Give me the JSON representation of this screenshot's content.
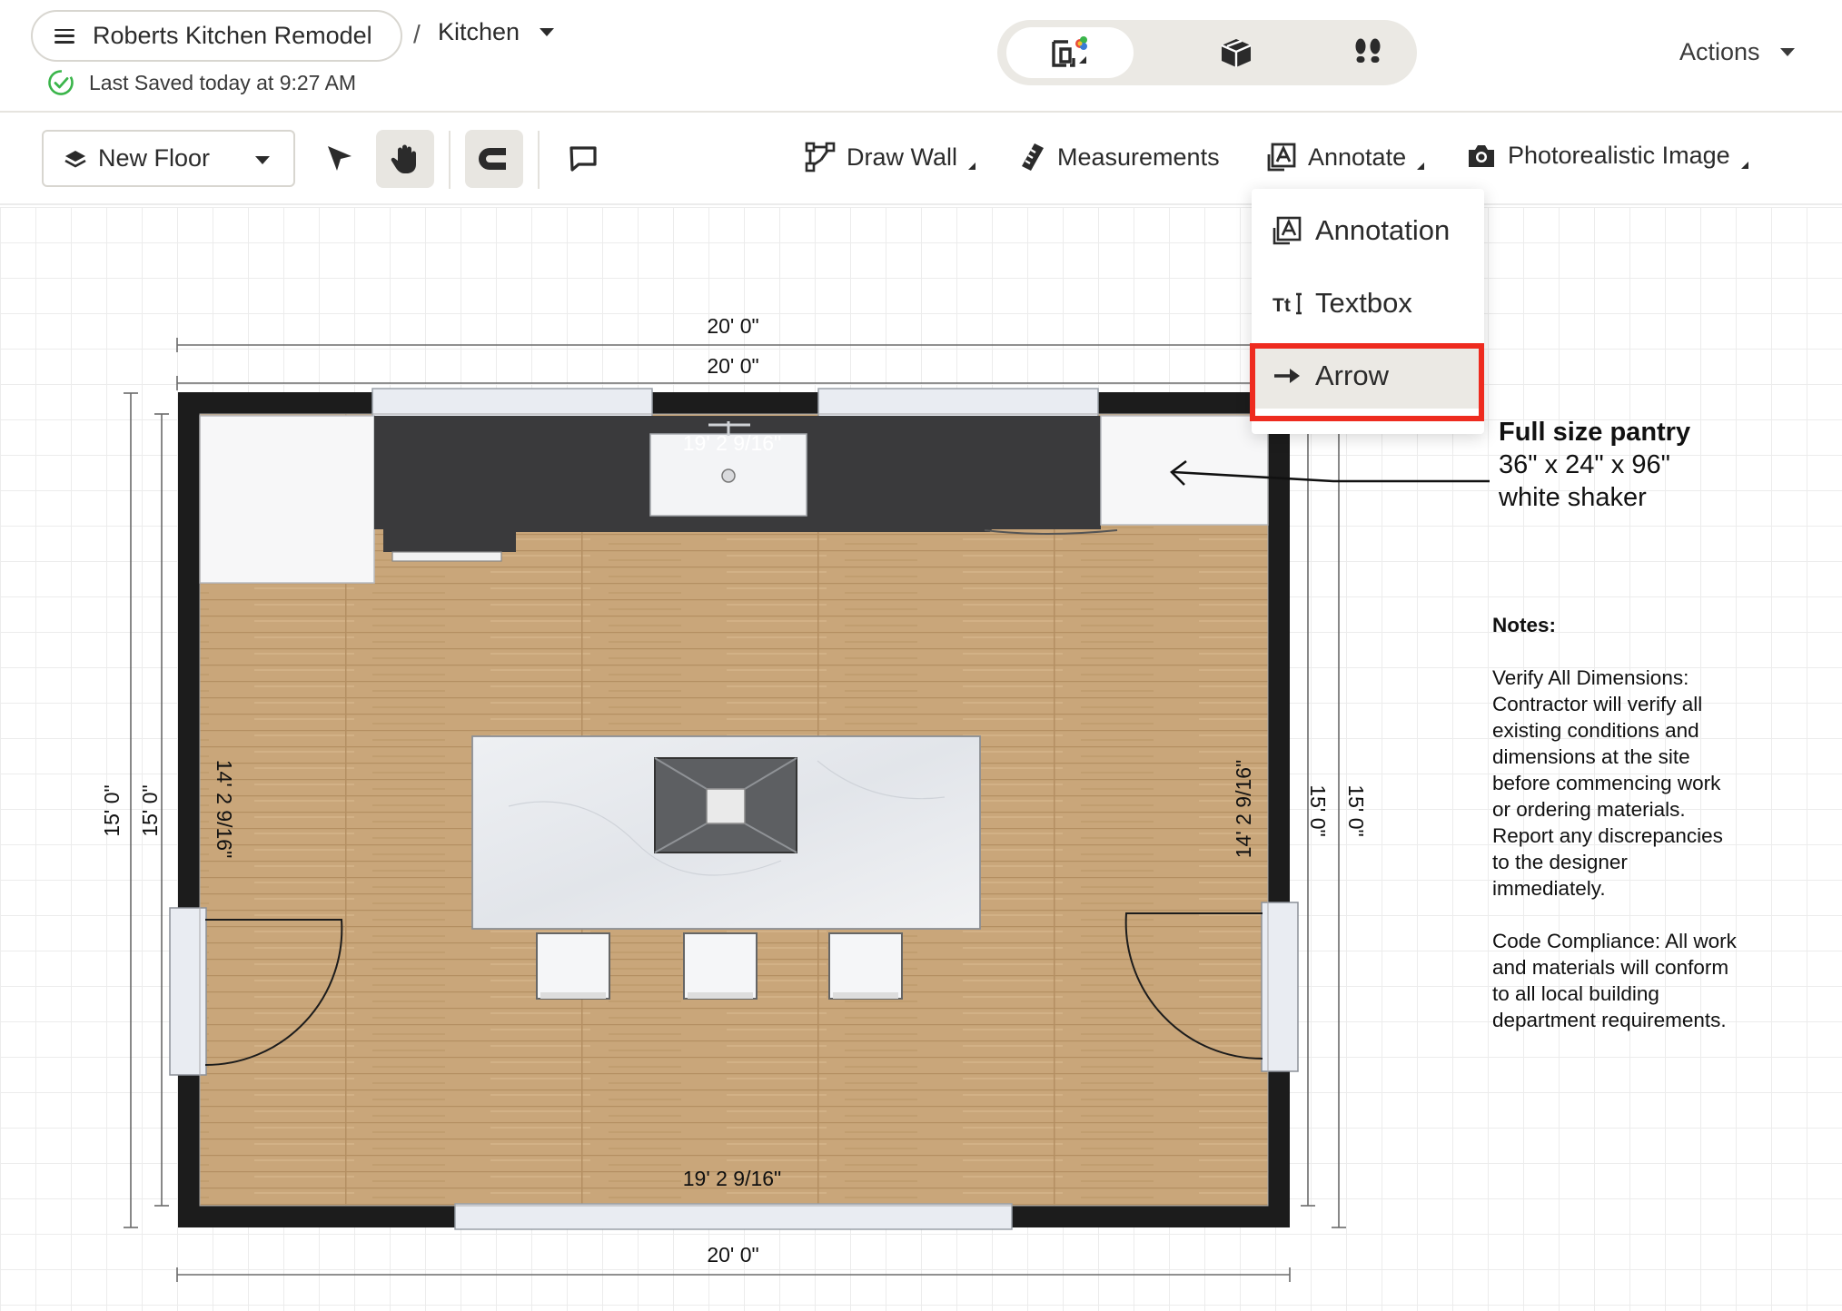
{
  "header": {
    "project_name": "Roberts Kitchen Remodel",
    "breadcrumb_separator": "/",
    "room_name": "Kitchen",
    "save_status": "Last Saved today at 9:27 AM",
    "actions_label": "Actions"
  },
  "view_toggle": {
    "items": [
      {
        "name": "2D floor plan view",
        "icon": "floorplan-2d-icon",
        "active": true
      },
      {
        "name": "3D view",
        "icon": "cube-3d-icon",
        "active": false
      },
      {
        "name": "Walkthrough view",
        "icon": "footprints-icon",
        "active": false
      }
    ]
  },
  "toolbar": {
    "floor_label": "New Floor",
    "draw_wall_label": "Draw Wall",
    "measurements_label": "Measurements",
    "annotate_label": "Annotate",
    "photo_label": "Photorealistic Image",
    "pan_active": true,
    "snap_active": true
  },
  "annotate_menu": {
    "items": [
      "Annotation",
      "Textbox",
      "Arrow"
    ],
    "highlighted": "Arrow"
  },
  "plan": {
    "dimensions": {
      "outer_top": "20' 0\"",
      "inner_top": "20' 0\"",
      "outer_bottom": "20' 0\"",
      "interior_top": "19' 2 9/16\"",
      "interior_bottom": "19' 2 9/16\"",
      "left_outer": "15' 0\"",
      "left_inner": "15' 0\"",
      "left_interior": "14' 2 9/16\"",
      "right_interior": "14' 2 9/16\"",
      "right_inner": "15' 0\"",
      "right_outer": "15' 0\""
    },
    "pantry_note": {
      "title": "Full size pantry",
      "line1": "36\" x 24\" x 96\"",
      "line2": "white shaker"
    },
    "notes": {
      "title": "Notes:",
      "p1": "Verify All Dimensions: Contractor will verify all existing conditions and dimensions at the site before commencing work or ordering materials. Report any discrepancies to the designer immediately.",
      "p2": "Code Compliance: All work and materials will conform to all local building department requirements."
    }
  },
  "colors": {
    "highlight": "#ee2b1f",
    "wall": "#1c1c1c",
    "countertop": "#3a3a3c",
    "floor_wood": "#c9a67a",
    "save_check": "#3ab54a"
  }
}
